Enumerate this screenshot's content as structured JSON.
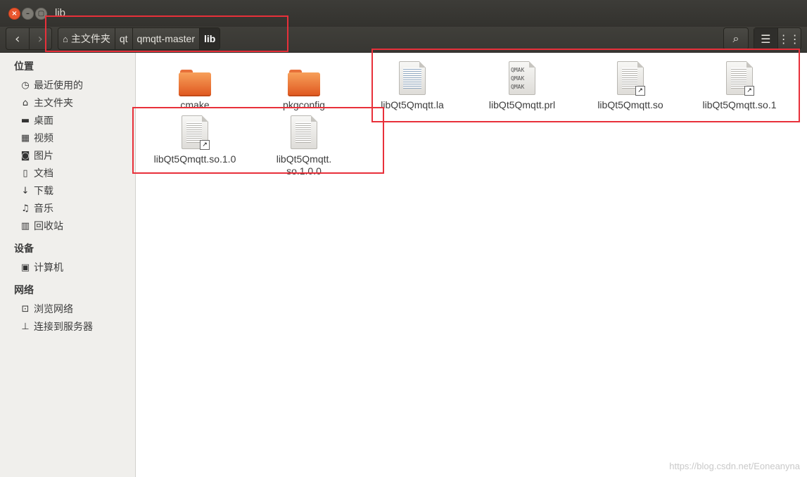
{
  "window": {
    "title": "lib",
    "close_glyph": "×",
    "min_glyph": "–",
    "max_glyph": "▢"
  },
  "navigation": {
    "back_icon": "‹",
    "forward_icon": "›"
  },
  "breadcrumbs": [
    {
      "label": "主文件夹",
      "icon": "home-icon"
    },
    {
      "label": "qt"
    },
    {
      "label": "qmqtt-master"
    },
    {
      "label": "lib",
      "active": true
    }
  ],
  "toolbar": {
    "search_icon": "⌕",
    "list_view_icon": "☰",
    "grid_view_icon": "⋮⋮"
  },
  "sidebar": {
    "sections": [
      {
        "label": "位置"
      },
      {
        "label": "设备"
      },
      {
        "label": "网络"
      }
    ],
    "items": [
      {
        "label": "最近使用的",
        "icon": "clock-icon",
        "glyph": "◷"
      },
      {
        "label": "主文件夹",
        "icon": "home-icon",
        "glyph": "⌂"
      },
      {
        "label": "桌面",
        "icon": "folder-icon",
        "glyph": "▬"
      },
      {
        "label": "视频",
        "icon": "film-icon",
        "glyph": "▦"
      },
      {
        "label": "图片",
        "icon": "camera-icon",
        "glyph": "◙"
      },
      {
        "label": "文档",
        "icon": "document-icon",
        "glyph": "▯"
      },
      {
        "label": "下载",
        "icon": "download-icon",
        "glyph": "↓"
      },
      {
        "label": "音乐",
        "icon": "music-icon",
        "glyph": "♫"
      },
      {
        "label": "回收站",
        "icon": "trash-icon",
        "glyph": "▥"
      },
      {
        "label": "计算机",
        "icon": "drive-icon",
        "glyph": "▣"
      },
      {
        "label": "浏览网络",
        "icon": "network-icon",
        "glyph": "⊡"
      },
      {
        "label": "连接到服务器",
        "icon": "server-icon",
        "glyph": "⊥"
      }
    ]
  },
  "files": [
    {
      "name": "cmake",
      "type": "folder"
    },
    {
      "name": "pkgconfig",
      "type": "folder"
    },
    {
      "name": "libQt5Qmqtt.la",
      "type": "text"
    },
    {
      "name": "libQt5Qmqtt.prl",
      "type": "qmake",
      "preview": "QMAK\nQMAK\nQMAK"
    },
    {
      "name": "libQt5Qmqtt.so",
      "type": "link"
    },
    {
      "name": "libQt5Qmqtt.so.1",
      "type": "link"
    },
    {
      "name": "libQt5Qmqtt.so.1.0",
      "type": "link"
    },
    {
      "name": "libQt5Qmqtt.\nso.1.0.0",
      "type": "doc"
    }
  ],
  "watermark": "https://blog.csdn.net/Eoneanyna",
  "colors": {
    "highlight": "#e8303a",
    "folder": "#e8703a",
    "titlebar": "#3c3b37"
  }
}
